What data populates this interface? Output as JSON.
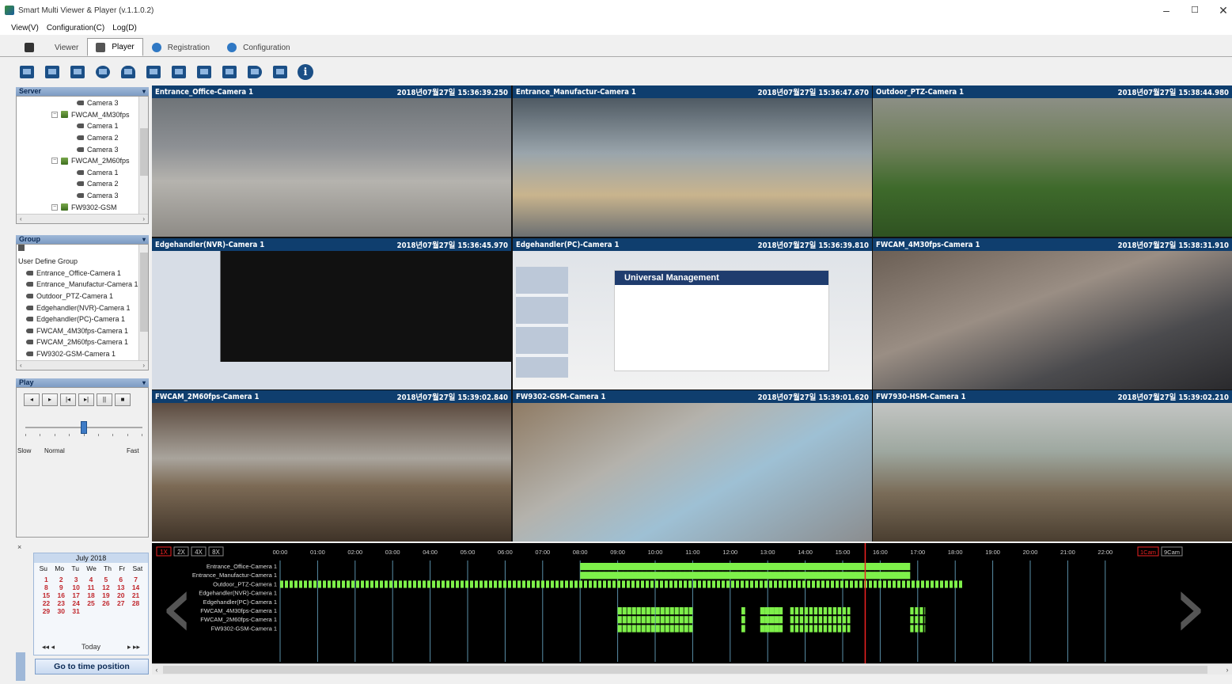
{
  "window": {
    "title": "Smart Multi Viewer & Player (v.1.1.0.2)",
    "controls": [
      "–",
      "☐",
      "✕"
    ]
  },
  "menu": [
    "View(V)",
    "Configuration(C)",
    "Log(D)"
  ],
  "tabs": [
    {
      "label": "Viewer",
      "active": false
    },
    {
      "label": "Player",
      "active": true
    },
    {
      "label": "Registration",
      "active": false
    },
    {
      "label": "Configuration",
      "active": false
    }
  ],
  "toolbar": {
    "icons": [
      "calendar-icon",
      "monitor-icon",
      "layout-icon",
      "settings-icon",
      "user-icon",
      "snapshot-icon",
      "print-icon",
      "window-icon",
      "display-icon",
      "speaker-icon",
      "export-icon",
      "info-icon"
    ],
    "info_glyph": "i"
  },
  "server_panel": {
    "title": "Server",
    "pin": "▾",
    "items": [
      {
        "label": "Camera 3",
        "type": "camera",
        "indent": 4
      },
      {
        "label": "FWCAM_4M30fps",
        "type": "device",
        "indent": 2
      },
      {
        "label": "Camera 1",
        "type": "camera",
        "indent": 4
      },
      {
        "label": "Camera 2",
        "type": "camera",
        "indent": 4
      },
      {
        "label": "Camera 3",
        "type": "camera",
        "indent": 4
      },
      {
        "label": "FWCAM_2M60fps",
        "type": "device",
        "indent": 2
      },
      {
        "label": "Camera 1",
        "type": "camera",
        "indent": 4
      },
      {
        "label": "Camera 2",
        "type": "camera",
        "indent": 4
      },
      {
        "label": "Camera 3",
        "type": "camera",
        "indent": 4
      },
      {
        "label": "FW9302-GSM",
        "type": "device",
        "indent": 2
      }
    ]
  },
  "group_panel": {
    "title": "Group",
    "pin": "▾",
    "items": [
      {
        "label": "User Define Group",
        "type": "root"
      },
      {
        "label": "Entrance_Office-Camera 1",
        "type": "camera"
      },
      {
        "label": "Entrance_Manufactur-Camera 1",
        "type": "camera"
      },
      {
        "label": "Outdoor_PTZ-Camera 1",
        "type": "camera"
      },
      {
        "label": "Edgehandler(NVR)-Camera 1",
        "type": "camera"
      },
      {
        "label": "Edgehandler(PC)-Camera 1",
        "type": "camera"
      },
      {
        "label": "FWCAM_4M30fps-Camera 1",
        "type": "camera"
      },
      {
        "label": "FWCAM_2M60fps-Camera 1",
        "type": "camera"
      },
      {
        "label": "FW9302-GSM-Camera 1",
        "type": "camera"
      }
    ]
  },
  "play_panel": {
    "title": "Play",
    "buttons": [
      "◂",
      "▸",
      "|◂",
      "▸|",
      "||",
      "■"
    ],
    "speed_labels": {
      "slow": "Slow",
      "normal": "Normal",
      "fast": "Fast"
    },
    "speed_value": 0.5
  },
  "cameras": [
    {
      "name": "Entrance_Office-Camera 1",
      "timestamp": "2018년07월27일 15:36:39.250",
      "scene": "office"
    },
    {
      "name": "Entrance_Manufactur-Camera 1",
      "timestamp": "2018년07월27일 15:36:47.670",
      "scene": "entrance"
    },
    {
      "name": "Outdoor_PTZ-Camera 1",
      "timestamp": "2018년07월27일 15:38:44.980",
      "scene": "outdoor"
    },
    {
      "name": "Edgehandler(NVR)-Camera 1",
      "timestamp": "2018년07월27일 15:36:45.970",
      "scene": "nvr"
    },
    {
      "name": "Edgehandler(PC)-Camera 1",
      "timestamp": "2018년07월27일 15:36:39.810",
      "scene": "pc"
    },
    {
      "name": "FWCAM_4M30fps-Camera 1",
      "timestamp": "2018년07월27일 15:38:31.910",
      "scene": "keyboard"
    },
    {
      "name": "FWCAM_2M60fps-Camera 1",
      "timestamp": "2018년07월27일 15:39:02.840",
      "scene": "meeting"
    },
    {
      "name": "FW9302-GSM-Camera 1",
      "timestamp": "2018년07월27일 15:39:01.620",
      "scene": "map"
    },
    {
      "name": "FW7930-HSM-Camera 1",
      "timestamp": "2018년07월27일 15:39:02.210",
      "scene": "people"
    }
  ],
  "pc_screen_heading": "Universal Management",
  "calendar": {
    "month": "July 2018",
    "weekdays": [
      "Su",
      "Mo",
      "Tu",
      "We",
      "Th",
      "Fr",
      "Sat"
    ],
    "days": [
      "1",
      "2",
      "3",
      "4",
      "5",
      "6",
      "7",
      "8",
      "9",
      "10",
      "11",
      "12",
      "13",
      "14",
      "15",
      "16",
      "17",
      "18",
      "19",
      "20",
      "21",
      "22",
      "23",
      "24",
      "25",
      "26",
      "27",
      "28",
      "29",
      "30",
      "31"
    ],
    "today_label": "Today",
    "prev": "◂◂  ◂",
    "next": "▸  ▸▸"
  },
  "goto_button": "Go to time position",
  "timeline": {
    "zoom_buttons": [
      "1X",
      "2X",
      "4X",
      "8X"
    ],
    "active_zoom": "1X",
    "hours": [
      "00:00",
      "01:00",
      "02:00",
      "03:00",
      "04:00",
      "05:00",
      "06:00",
      "07:00",
      "08:00",
      "09:00",
      "10:00",
      "11:00",
      "12:00",
      "13:00",
      "14:00",
      "15:00",
      "16:00",
      "17:00",
      "18:00",
      "19:00",
      "20:00",
      "21:00",
      "22:00"
    ],
    "right_buttons": [
      "1Cam",
      "9Cam"
    ],
    "rows": [
      "Entrance_Office-Camera 1",
      "Entrance_Manufactur-Camera 1",
      "Outdoor_PTZ-Camera 1",
      "Edgehandler(NVR)-Camera 1",
      "Edgehandler(PC)-Camera 1",
      "FWCAM_4M30fps-Camera 1",
      "FWCAM_2M60fps-Camera 1",
      "FW9302-GSM-Camera 1"
    ],
    "recordings": [
      [
        [
          8.0,
          16.8
        ]
      ],
      [
        [
          8.0,
          16.8
        ]
      ],
      [
        [
          0.0,
          18.2
        ]
      ],
      [],
      [],
      [
        [
          9.0,
          11.0
        ],
        [
          12.3,
          12.4
        ],
        [
          12.8,
          13.4
        ],
        [
          13.6,
          15.2
        ],
        [
          16.8,
          17.2
        ]
      ],
      [
        [
          9.0,
          11.0
        ],
        [
          12.3,
          12.4
        ],
        [
          12.8,
          13.4
        ],
        [
          13.6,
          15.2
        ],
        [
          16.8,
          17.2
        ]
      ],
      [
        [
          9.0,
          11.0
        ],
        [
          12.3,
          12.4
        ],
        [
          12.8,
          13.4
        ],
        [
          13.6,
          15.2
        ],
        [
          16.8,
          17.2
        ]
      ]
    ],
    "current_time": 15.6,
    "chevron_left": "‹",
    "chevron_right": "›"
  }
}
